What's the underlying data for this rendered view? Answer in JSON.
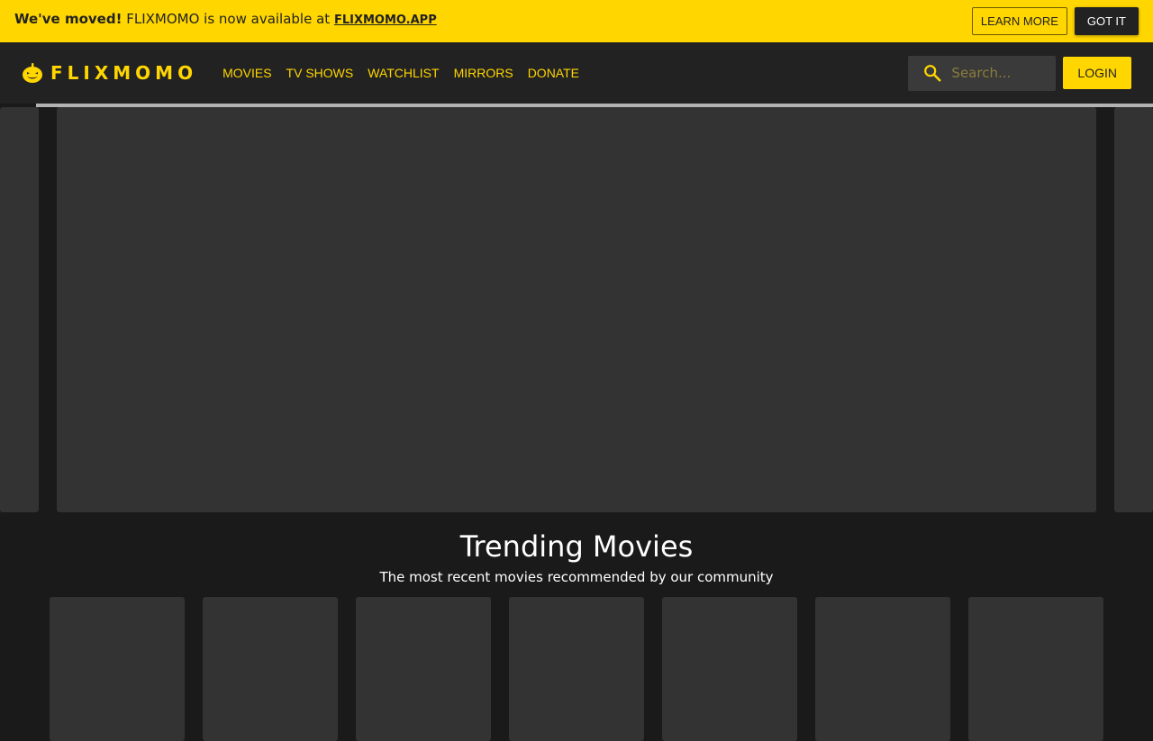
{
  "banner": {
    "bold_text": "We've moved!",
    "message": "FLIXMOMO is now available at",
    "link_text": "FLIXMOMO.APP",
    "learn_more_label": "LEARN MORE",
    "got_it_label": "GOT IT"
  },
  "nav": {
    "logo_text": "FLIXMOMO",
    "links": [
      "MOVIES",
      "TV SHOWS",
      "WATCHLIST",
      "MIRRORS",
      "DONATE"
    ],
    "search_placeholder": "Search...",
    "login_label": "LOGIN"
  },
  "trending": {
    "title": "Trending Movies",
    "subtitle": "The most recent movies recommended by our community"
  },
  "colors": {
    "accent": "#ffd600",
    "nav_bg": "#222222",
    "page_bg": "#1a1a1a",
    "placeholder_bg": "#333333"
  },
  "icons": {
    "logo": "pumpkin-icon",
    "search": "search-icon"
  }
}
